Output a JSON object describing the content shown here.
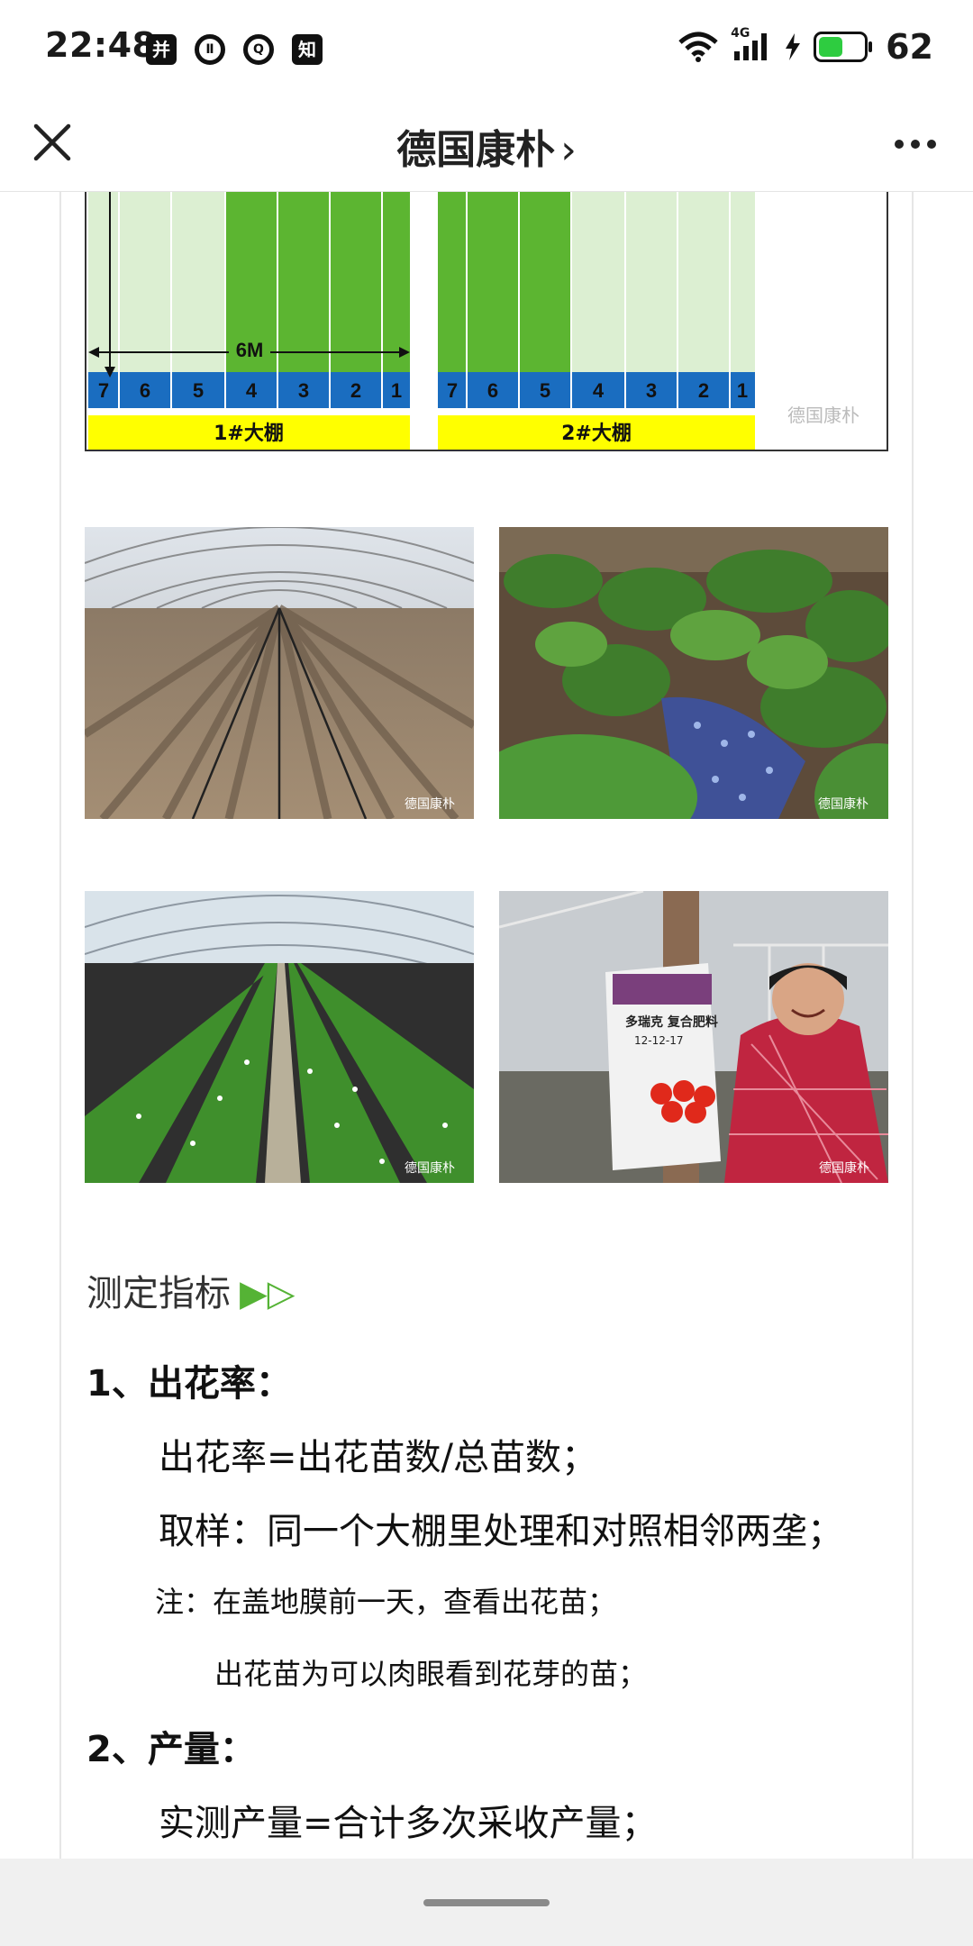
{
  "status_bar": {
    "time": "22:48",
    "notification_icons": [
      "并",
      "Ⅱ",
      "Q",
      "知"
    ],
    "network": "4G",
    "battery": 62
  },
  "nav": {
    "title": "德国康朴",
    "title_chevron": "›"
  },
  "diagram": {
    "width_label": "6M",
    "greenhouse1": {
      "numbers": [
        "7",
        "6",
        "5",
        "4",
        "3",
        "2",
        "1"
      ],
      "label": "1#大棚"
    },
    "greenhouse2": {
      "numbers": [
        "7",
        "6",
        "5",
        "4",
        "3",
        "2",
        "1"
      ],
      "label": "2#大棚"
    },
    "watermark": "德国康朴"
  },
  "photos": {
    "watermark": "德国康朴",
    "bag_label": "多瑞克 复合肥料",
    "bag_npk": "12-12-17"
  },
  "article": {
    "section_heading": "测定指标",
    "section_arrows": "▶▷",
    "item1_title": "1、出花率：",
    "item1_formula": "出花率=出花苗数/总苗数；",
    "item1_sampling": "取样：同一个大棚里处理和对照相邻两垄；",
    "item1_note1": "注：在盖地膜前一天，查看出花苗；",
    "item1_note2": "出花苗为可以肉眼看到花芽的苗；",
    "item2_title": "2、产量：",
    "item2_formula": "实测产量=合计多次采收产量；"
  },
  "colors": {
    "dark_green": "#5cb531",
    "light_green": "#dcefd2",
    "blue_row": "#1a6dc0",
    "yellow_label": "#ffff00",
    "accent": "#55b335"
  }
}
